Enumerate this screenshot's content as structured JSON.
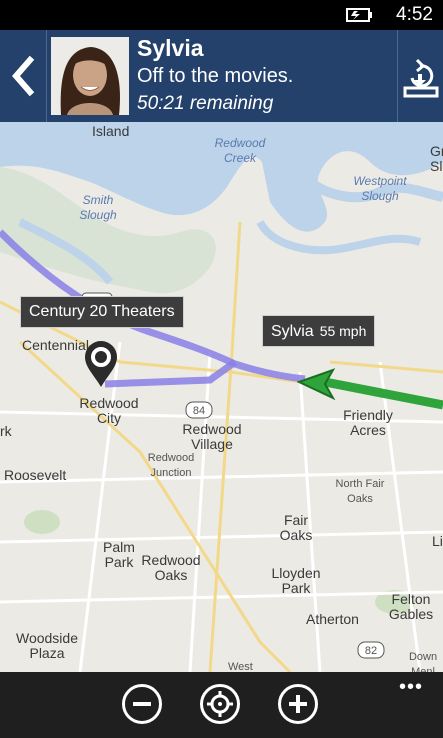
{
  "status": {
    "time": "4:52",
    "battery_icon": "battery-charging-icon"
  },
  "header": {
    "back_icon": "back-arrow-icon",
    "name": "Sylvia",
    "subtitle": "Off to the movies.",
    "remaining": "50:21 remaining",
    "share_icon": "share-location-icon"
  },
  "map": {
    "destination": {
      "label": "Century 20 Theaters",
      "icon": "map-pin-icon"
    },
    "person": {
      "name": "Sylvia",
      "speed": "55 mph",
      "icon": "direction-arrow-icon"
    },
    "places": [
      "Island",
      "Redwood Creek",
      "Smith Slough",
      "Westpoint Slough",
      "Gr Sl",
      "Centennial",
      "Redwood City",
      "Redwood Village",
      "Redwood Junction",
      "Friendly Acres",
      "North Fair Oaks",
      "Roosevelt",
      "Fair Oaks",
      "Palm Park",
      "Redwood Oaks",
      "Lloyden Park",
      "Atherton",
      "Felton Gables",
      "Woodside Plaza",
      "West",
      "Down Menl",
      "rk",
      "Li"
    ],
    "shields": [
      "101",
      "84",
      "82"
    ]
  },
  "app_bar": {
    "zoom_out_icon": "zoom-out-icon",
    "locate_icon": "locate-icon",
    "zoom_in_icon": "zoom-in-icon",
    "more_label": "•••"
  },
  "colors": {
    "header": "#23416a",
    "route_purple": "#8a7fe8",
    "route_green": "#2ea43a",
    "water": "#bcd3ea"
  }
}
